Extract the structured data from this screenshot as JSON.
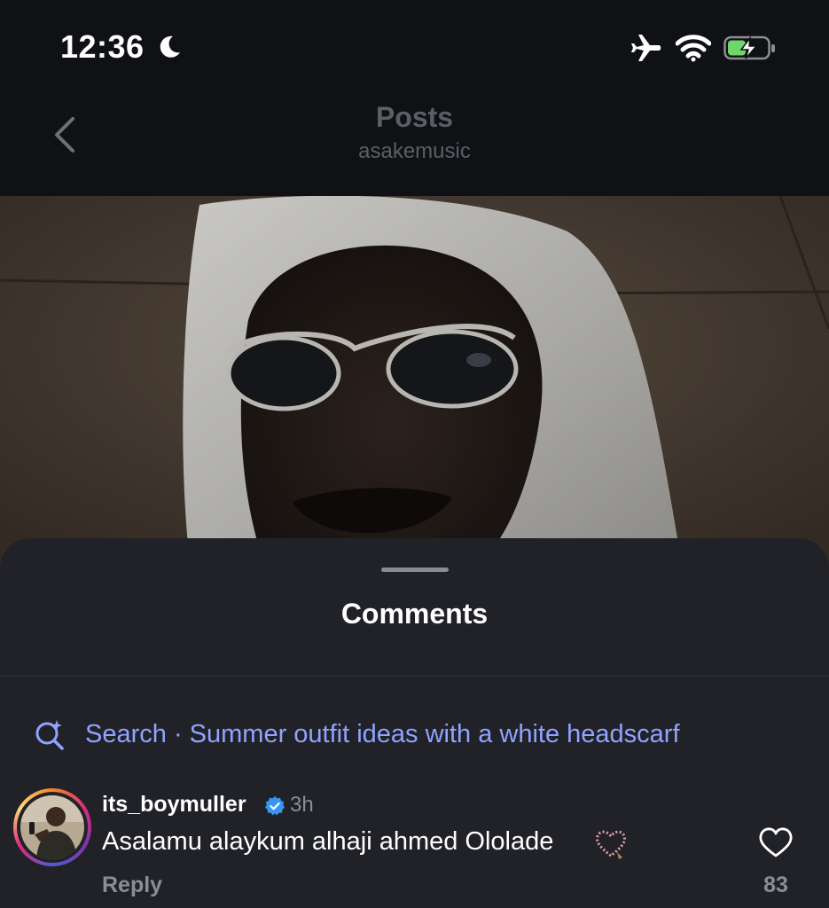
{
  "status_bar": {
    "time": "12:36",
    "icons": [
      "moon-icon",
      "airplane-icon",
      "wifi-icon",
      "battery-charging-icon"
    ],
    "battery_color": "#6fd76a"
  },
  "header": {
    "title": "Posts",
    "subtitle": "asakemusic",
    "back_icon": "chevron-left-icon"
  },
  "sheet": {
    "title": "Comments"
  },
  "search": {
    "icon": "search-sparkle-icon",
    "text": "Search · Summer outfit ideas with a white headscarf",
    "color": "#8fa3ff"
  },
  "comment": {
    "username": "its_boymuller",
    "verified": true,
    "time": "3h",
    "text": "Asalamu alaykum alhaji ahmed Ololade",
    "emoji": "prayer-beads-heart-icon",
    "reply_label": "Reply",
    "like_count": "83"
  },
  "colors": {
    "background": "#0f1115",
    "sheet": "#212227",
    "muted_text": "#8b8d93",
    "verified_blue": "#3897f0"
  }
}
